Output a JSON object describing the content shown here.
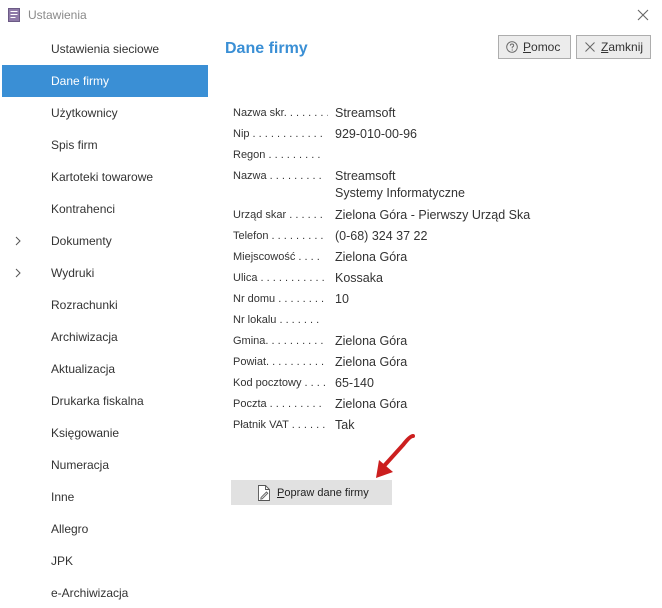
{
  "window": {
    "title": "Ustawienia"
  },
  "header": {
    "title": "Dane firmy",
    "help_label": "Pomoc",
    "close_label": "Zamknij"
  },
  "sidebar": {
    "items": [
      {
        "label": "Ustawienia sieciowe",
        "active": false,
        "expandable": false
      },
      {
        "label": "Dane firmy",
        "active": true,
        "expandable": false
      },
      {
        "label": "Użytkownicy",
        "active": false,
        "expandable": false
      },
      {
        "label": "Spis firm",
        "active": false,
        "expandable": false
      },
      {
        "label": "Kartoteki towarowe",
        "active": false,
        "expandable": false
      },
      {
        "label": "Kontrahenci",
        "active": false,
        "expandable": false
      },
      {
        "label": "Dokumenty",
        "active": false,
        "expandable": true
      },
      {
        "label": "Wydruki",
        "active": false,
        "expandable": true
      },
      {
        "label": "Rozrachunki",
        "active": false,
        "expandable": false
      },
      {
        "label": "Archiwizacja",
        "active": false,
        "expandable": false
      },
      {
        "label": "Aktualizacja",
        "active": false,
        "expandable": false
      },
      {
        "label": "Drukarka fiskalna",
        "active": false,
        "expandable": false
      },
      {
        "label": "Księgowanie",
        "active": false,
        "expandable": false
      },
      {
        "label": "Numeracja",
        "active": false,
        "expandable": false
      },
      {
        "label": "Inne",
        "active": false,
        "expandable": false
      },
      {
        "label": "Allegro",
        "active": false,
        "expandable": false
      },
      {
        "label": "JPK",
        "active": false,
        "expandable": false
      },
      {
        "label": "e-Archiwizacja",
        "active": false,
        "expandable": false
      }
    ]
  },
  "details": {
    "rows": [
      {
        "label": "Nazwa skr. . . . . . . .",
        "value": "Streamsoft"
      },
      {
        "label": "Nip . . . . . . . . . . . .",
        "value": "929-010-00-96"
      },
      {
        "label": "Regon . . . . . . . . .",
        "value": ""
      },
      {
        "label": "Nazwa . . . . . . . . .",
        "value": "Streamsoft",
        "value2": "Systemy Informatyczne"
      },
      {
        "label": "Urząd skar . . . . . .",
        "value": "Zielona Góra - Pierwszy Urząd Ska"
      },
      {
        "label": "Telefon . . . . . . . . .",
        "value": "(0-68) 324 37 22"
      },
      {
        "label": "Miejscowość . . . .",
        "value": "Zielona Góra"
      },
      {
        "label": "Ulica . . . . . . . . . . .",
        "value": "Kossaka"
      },
      {
        "label": "Nr domu . . . . . . . .",
        "value": "10"
      },
      {
        "label": "Nr lokalu . . . . . . .",
        "value": ""
      },
      {
        "label": "Gmina. . . . . . . . . .",
        "value": "Zielona Góra"
      },
      {
        "label": "Powiat. . . . . . . . . .",
        "value": "Zielona Góra"
      },
      {
        "label": "Kod pocztowy . . . .",
        "value": "65-140"
      },
      {
        "label": "Poczta . . . . . . . . .",
        "value": "Zielona Góra"
      },
      {
        "label": "Płatnik VAT . . . . . .",
        "value": "Tak"
      }
    ]
  },
  "edit_button": {
    "label": "Popraw dane firmy"
  },
  "colors": {
    "accent": "#3a8fd5",
    "arrow": "#cc1f1f",
    "button_bg": "#e1e1e1"
  },
  "icons": {
    "app": "document-icon",
    "close": "close-icon",
    "help": "question-icon",
    "edit": "edit-document-icon",
    "expand": "chevron-right-icon"
  }
}
